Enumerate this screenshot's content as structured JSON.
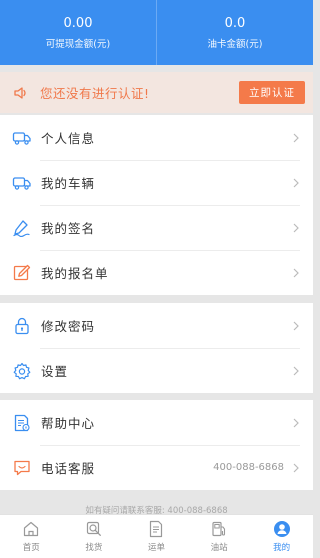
{
  "header": {
    "withdrawable_value": "0.00",
    "withdrawable_label": "可提现金额(元)",
    "fuel_card_value": "0.0",
    "fuel_card_label": "油卡金额(元)"
  },
  "banner": {
    "message": "您还没有进行认证!",
    "button_label": "立即认证",
    "icon": "speaker-icon"
  },
  "menu_group_1": [
    {
      "label": "个人信息",
      "icon": "truck-icon"
    },
    {
      "label": "我的车辆",
      "icon": "truck-icon"
    },
    {
      "label": "我的签名",
      "icon": "signature-pen-icon"
    },
    {
      "label": "我的报名单",
      "icon": "edit-form-icon"
    }
  ],
  "menu_group_2": [
    {
      "label": "修改密码",
      "icon": "lock-icon"
    },
    {
      "label": "设置",
      "icon": "gear-icon"
    }
  ],
  "menu_group_3": [
    {
      "label": "帮助中心",
      "icon": "help-document-icon"
    },
    {
      "label": "电话客服",
      "icon": "chat-icon",
      "extra": "400-088-6868"
    }
  ],
  "footer_note": "如有疑问请联系客服: 400-088-6868",
  "tabbar": [
    {
      "label": "首页",
      "icon": "home-icon"
    },
    {
      "label": "找货",
      "icon": "find-goods-icon"
    },
    {
      "label": "运单",
      "icon": "waybill-icon"
    },
    {
      "label": "油站",
      "icon": "fuel-station-icon"
    },
    {
      "label": "我的",
      "icon": "profile-icon",
      "active": true
    }
  ],
  "colors": {
    "primary": "#3a8ef0",
    "warning": "#f47a4a",
    "banner_bg": "#f3e6e0"
  }
}
